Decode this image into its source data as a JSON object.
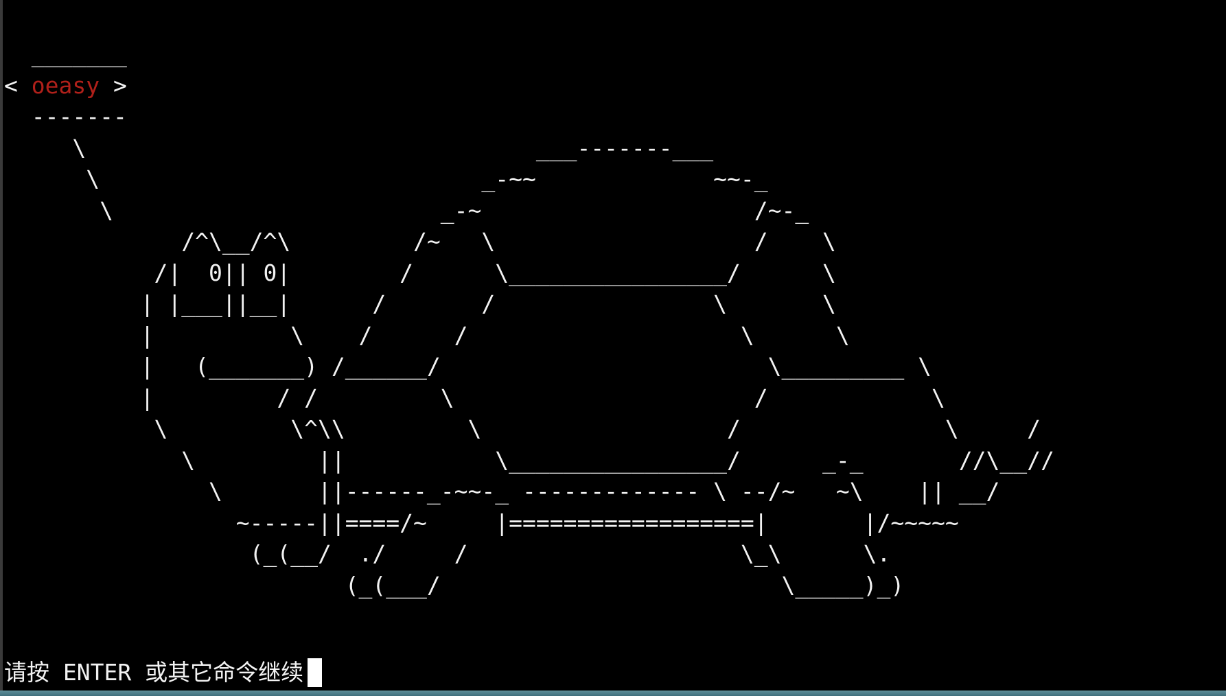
{
  "terminal": {
    "bubble": {
      "top_border": "  _______",
      "left": "< ",
      "text": "oeasy",
      "right": " >",
      "bottom_border": "  -------"
    },
    "cow_lines": [
      "     \\",
      "      \\",
      "       \\",
      "             /^\\__/^\\          /~   \\                        /    \\",
      "           /|  0|| 0|         /      \\________________/      \\",
      "          | |___||__|       /      /                  \\      \\",
      "          |         \\      /      /                    \\      \\",
      "          |   (_______) /______/                        \\_________ \\",
      "          |         / /         \\                      /            \\",
      "           \\         \\^\\\\         \\                  /               \\     /",
      "             \\         ||           \\________________/      _-_       //\\__//",
      "               \\       ||------_-~~-_ ------------- \\ --/~   ~\\    || __/",
      "                 ~-----||====/~     |==================|       |/~~~~~",
      "                  (_(__/  ./     /                    \\_\\      \\.",
      "                         (_(___/                         \\_____)_)"
    ],
    "shell_top": [
      "                                       ___-------___",
      "                                   _-~~             ~~-_",
      "                                _-~                    /~-_"
    ]
  },
  "prompt": {
    "text": "请按 ENTER 或其它命令继续"
  },
  "colors": {
    "background": "#000000",
    "foreground": "#f2f2f2",
    "accent_text": "#b0201a",
    "status_bar": "#4f7f8a"
  }
}
